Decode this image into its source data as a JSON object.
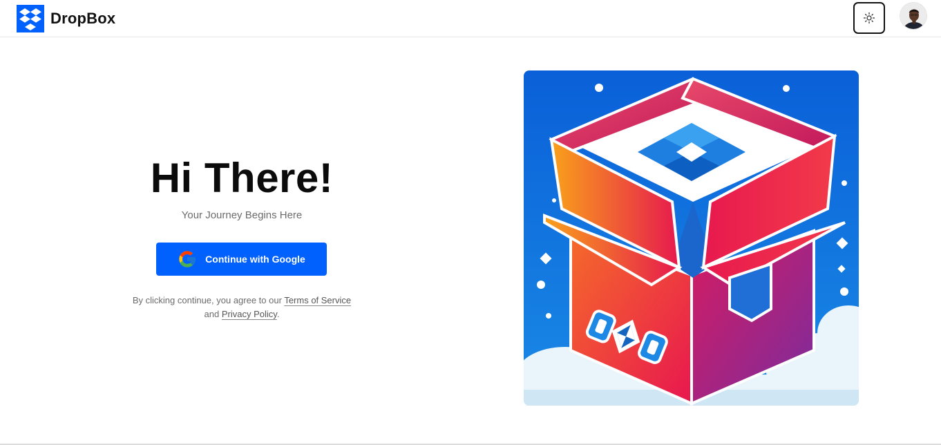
{
  "header": {
    "brand_name": "DropBox",
    "logo_icon": "dropbox-logo-icon",
    "theme_toggle_icon": "sun-icon",
    "avatar_icon": "user-avatar"
  },
  "hero": {
    "title": "Hi There!",
    "subtitle": "Your Journey Begins Here",
    "google_button_label": "Continue with Google",
    "google_icon": "google-g-icon",
    "legal_prefix": "By clicking continue, you agree to our ",
    "terms_link": "Terms of Service",
    "legal_and": "and ",
    "privacy_link": "Privacy Policy",
    "legal_suffix": "."
  },
  "illustration": {
    "icon": "dropbox-box-illustration"
  },
  "colors": {
    "brand_blue": "#0061fe",
    "text_dark": "#0b0b0b",
    "text_muted": "#6b6b6b"
  }
}
